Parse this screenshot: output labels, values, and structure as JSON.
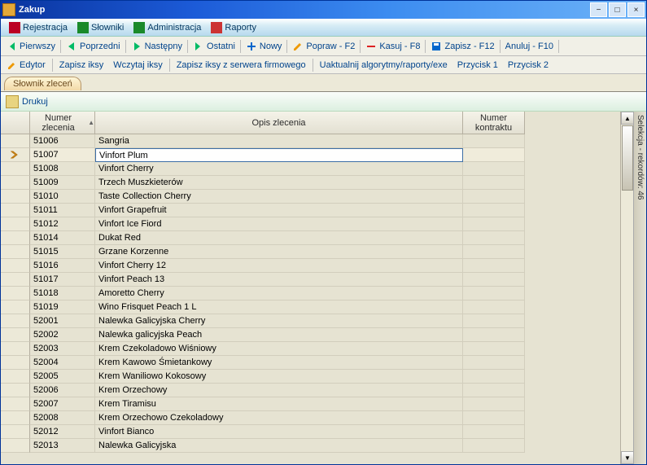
{
  "window": {
    "title": "Zakup"
  },
  "menubar": [
    {
      "label": "Rejestracja"
    },
    {
      "label": "Słowniki"
    },
    {
      "label": "Administracja"
    },
    {
      "label": "Raporty"
    }
  ],
  "toolbar1": {
    "first": "Pierwszy",
    "prev": "Poprzedni",
    "next": "Następny",
    "last": "Ostatni",
    "new": "Nowy",
    "edit": "Popraw - F2",
    "delete": "Kasuj - F8",
    "save": "Zapisz - F12",
    "cancel": "Anuluj - F10"
  },
  "toolbar2": {
    "editor": "Edytor",
    "save_iksy": "Zapisz iksy",
    "load_iksy": "Wczytaj iksy",
    "save_iksy_server": "Zapisz iksy z serwera firmowego",
    "update": "Uaktualnij algorytmy/raporty/exe",
    "btn1": "Przycisk 1",
    "btn2": "Przycisk 2"
  },
  "tab": {
    "label": "Słownik zleceń"
  },
  "print": {
    "label": "Drukuj"
  },
  "grid": {
    "col_num": "Numer zlecenia",
    "col_desc": "Opis zlecenia",
    "col_kontr": "Numer kontraktu",
    "rows": [
      {
        "num": "51006",
        "desc": "Sangria"
      },
      {
        "num": "51007",
        "desc": "Vinfort Plum",
        "selected": true
      },
      {
        "num": "51008",
        "desc": "Vinfort Cherry"
      },
      {
        "num": "51009",
        "desc": "Trzech Muszkieterów"
      },
      {
        "num": "51010",
        "desc": "Taste Collection Cherry"
      },
      {
        "num": "51011",
        "desc": "Vinfort Grapefruit"
      },
      {
        "num": "51012",
        "desc": "Vinfort Ice Fiord"
      },
      {
        "num": "51014",
        "desc": "Dukat Red"
      },
      {
        "num": "51015",
        "desc": "Grzane Korzenne"
      },
      {
        "num": "51016",
        "desc": "Vinfort Cherry 12"
      },
      {
        "num": "51017",
        "desc": "Vinfort Peach 13"
      },
      {
        "num": "51018",
        "desc": "Amoretto Cherry"
      },
      {
        "num": "51019",
        "desc": "Wino Frisquet Peach 1 L"
      },
      {
        "num": "52001",
        "desc": "Nalewka Galicyjska Cherry"
      },
      {
        "num": "52002",
        "desc": "Nalewka galicyjska Peach"
      },
      {
        "num": "52003",
        "desc": "Krem Czekoladowo Wiśniowy"
      },
      {
        "num": "52004",
        "desc": "Krem Kawowo Śmietankowy"
      },
      {
        "num": "52005",
        "desc": "Krem Waniliowo Kokosowy"
      },
      {
        "num": "52006",
        "desc": "Krem Orzechowy"
      },
      {
        "num": "52007",
        "desc": "Krem Tiramisu"
      },
      {
        "num": "52008",
        "desc": "Krem Orzechowo Czekoladowy"
      },
      {
        "num": "52012",
        "desc": "Vinfort Bianco"
      },
      {
        "num": "52013",
        "desc": "Nalewka Galicyjska"
      }
    ]
  },
  "side": {
    "label": "Selekcja - rekordów: 46"
  }
}
